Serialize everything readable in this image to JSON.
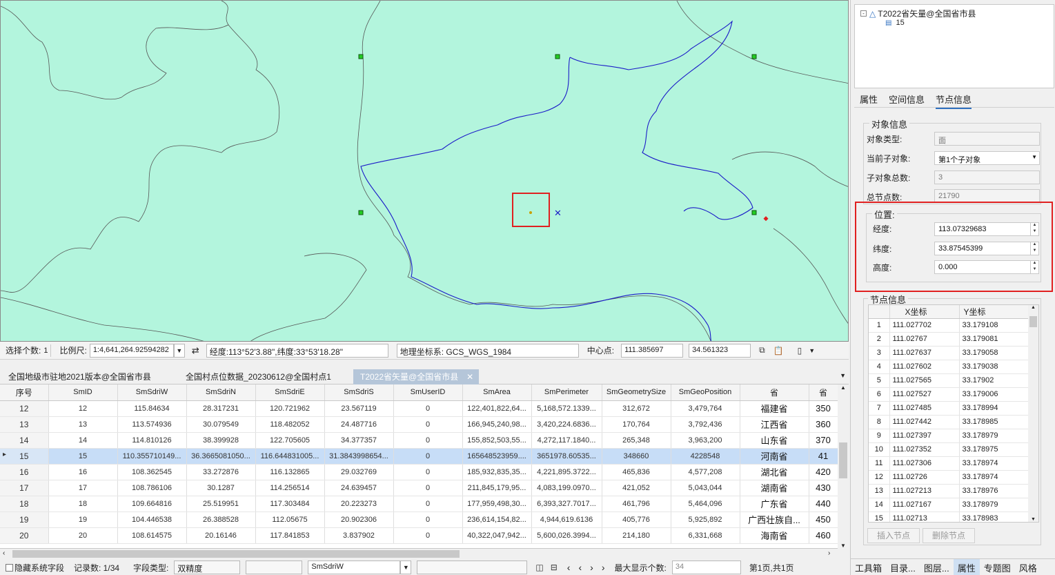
{
  "statusbar": {
    "select_label": "选择个数:",
    "select_value": "1",
    "scale_label": "比例尺:",
    "scale_value": "1:4,641,264.92594282",
    "coord_readout": "经度:113°52'3.88\",纬度:33°53'18.28\"",
    "crs": "地理坐标系: GCS_WGS_1984",
    "center_label": "中心点:",
    "center_x": "111.385697",
    "center_y": "34.561323"
  },
  "tabs": [
    "全国地级市驻地2021版本@全国省市县",
    "全国村点位数据_20230612@全国村点1",
    "T2022省矢量@全国省市县"
  ],
  "grid": {
    "headers": [
      "序号",
      "SmID",
      "SmSdriW",
      "SmSdriN",
      "SmSdriE",
      "SmSdriS",
      "SmUserID",
      "SmArea",
      "SmPerimeter",
      "SmGeometrySize",
      "SmGeoPosition",
      "省",
      "省"
    ],
    "rows": [
      {
        "idx": "12",
        "c": [
          "12",
          "115.84634",
          "28.317231",
          "120.721962",
          "23.567119",
          "0",
          "122,401,822,64...",
          "5,168,572.1339...",
          "312,672",
          "3,479,764",
          "福建省",
          "350"
        ]
      },
      {
        "idx": "13",
        "c": [
          "13",
          "113.574936",
          "30.079549",
          "118.482052",
          "24.487716",
          "0",
          "166,945,240,98...",
          "3,420,224.6836...",
          "170,764",
          "3,792,436",
          "江西省",
          "360"
        ]
      },
      {
        "idx": "14",
        "c": [
          "14",
          "114.810126",
          "38.399928",
          "122.705605",
          "34.377357",
          "0",
          "155,852,503,55...",
          "4,272,117.1840...",
          "265,348",
          "3,963,200",
          "山东省",
          "370"
        ]
      },
      {
        "idx": "15",
        "c": [
          "15",
          "110.355710149...",
          "36.3665081050...",
          "116.644831005...",
          "31.3843998654...",
          "0",
          "165648523959....",
          "3651978.60535...",
          "348660",
          "4228548",
          "河南省",
          "41"
        ]
      },
      {
        "idx": "16",
        "c": [
          "16",
          "108.362545",
          "33.272876",
          "116.132865",
          "29.032769",
          "0",
          "185,932,835,35...",
          "4,221,895.3722...",
          "465,836",
          "4,577,208",
          "湖北省",
          "420"
        ]
      },
      {
        "idx": "17",
        "c": [
          "17",
          "108.786106",
          "30.1287",
          "114.256514",
          "24.639457",
          "0",
          "211,845,179,95...",
          "4,083,199.0970...",
          "421,052",
          "5,043,044",
          "湖南省",
          "430"
        ]
      },
      {
        "idx": "18",
        "c": [
          "18",
          "109.664816",
          "25.519951",
          "117.303484",
          "20.223273",
          "0",
          "177,959,498,30...",
          "6,393,327.7017...",
          "461,796",
          "5,464,096",
          "广东省",
          "440"
        ]
      },
      {
        "idx": "19",
        "c": [
          "19",
          "104.446538",
          "26.388528",
          "112.05675",
          "20.902306",
          "0",
          "236,614,154,82...",
          "4,944,619.6136",
          "405,776",
          "5,925,892",
          "广西壮族自...",
          "450"
        ]
      },
      {
        "idx": "20",
        "c": [
          "20",
          "108.614575",
          "20.16146",
          "117.841853",
          "3.837902",
          "0",
          "40,322,047,942...",
          "5,600,026.3994...",
          "214,180",
          "6,331,668",
          "海南省",
          "460"
        ]
      }
    ]
  },
  "bottombar": {
    "hide_sys": "隐藏系统字段",
    "records": "记录数: 1/34",
    "field_type_label": "字段类型:",
    "field_type": "双精度",
    "field_name": "SmSdriW",
    "max_label": "最大显示个数:",
    "max_value": "34",
    "page": "第1页,共1页"
  },
  "tree": {
    "root": "T2022省矢量@全国省市县",
    "child": "15"
  },
  "ptabs": [
    "属性",
    "空间信息",
    "节点信息"
  ],
  "obj": {
    "group": "对象信息",
    "type_label": "对象类型:",
    "type_value": "面",
    "sub_label": "当前子对象:",
    "sub_value": "第1个子对象",
    "subtotal_label": "子对象总数:",
    "subtotal_value": "3",
    "nodes_label": "总节点数:",
    "nodes_value": "21790"
  },
  "pos": {
    "group": "位置:",
    "lon_label": "经度:",
    "lon_value": "113.07329683",
    "lat_label": "纬度:",
    "lat_value": "33.87545399",
    "alt_label": "高度:",
    "alt_value": "0.000"
  },
  "nodeinfo": {
    "group": "节点信息",
    "headers": [
      "X坐标",
      "Y坐标"
    ],
    "rows": [
      [
        "1",
        "111.027702",
        "33.179108"
      ],
      [
        "2",
        "111.02767",
        "33.179081"
      ],
      [
        "3",
        "111.027637",
        "33.179058"
      ],
      [
        "4",
        "111.027602",
        "33.179038"
      ],
      [
        "5",
        "111.027565",
        "33.17902"
      ],
      [
        "6",
        "111.027527",
        "33.179006"
      ],
      [
        "7",
        "111.027485",
        "33.178994"
      ],
      [
        "8",
        "111.027442",
        "33.178985"
      ],
      [
        "9",
        "111.027397",
        "33.178979"
      ],
      [
        "10",
        "111.027352",
        "33.178975"
      ],
      [
        "11",
        "111.027306",
        "33.178974"
      ],
      [
        "12",
        "111.02726",
        "33.178974"
      ],
      [
        "13",
        "111.027213",
        "33.178976"
      ],
      [
        "14",
        "111.027167",
        "33.178979"
      ],
      [
        "15",
        "111.02713",
        "33.178983"
      ]
    ],
    "insert": "插入节点",
    "delete": "删除节点"
  },
  "dock": [
    "工具箱",
    "目录...",
    "图层...",
    "属性",
    "专题图",
    "风格"
  ],
  "colors": {
    "map_bg": "#b3f5dd",
    "boundary": "#1a1ac8",
    "highlight": "#e02020",
    "handle": "#22aa22"
  }
}
